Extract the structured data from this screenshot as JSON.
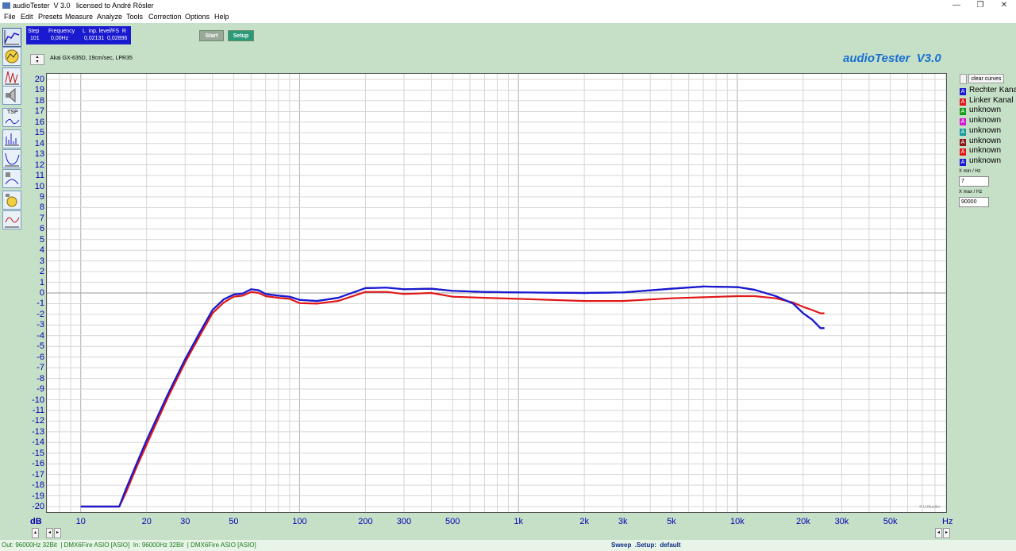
{
  "window": {
    "title": "audioTester  V 3.0   licensed to André Rösler",
    "minimize": "—",
    "maximize": "❐",
    "close": "✕"
  },
  "menu": [
    "File",
    "Edit",
    "Presets",
    "Measure",
    "Analyze",
    "Tools",
    "Correction",
    "Options",
    "Help"
  ],
  "info": {
    "step_label": "Step",
    "frequency_label": "Frequency",
    "level_label": "L  inp. level/FS  R",
    "step_value": "101",
    "frequency_value": "0,00Hz",
    "level_l": "0,02131",
    "level_r": "0,02896"
  },
  "buttons": {
    "start": "Start",
    "setup": "Setup",
    "clear_curves": "clear curves"
  },
  "curve_name": "Akai GX-635D, 19cm/sec, LPR35",
  "app_title": "audioTester  V3.0",
  "toolbar_tsp": "TSP",
  "legend": [
    {
      "label": "Rechter Kanal",
      "color": "#1a1ad0"
    },
    {
      "label": "Linker Kanal",
      "color": "#e01818"
    },
    {
      "label": "unknown",
      "color": "#1a9a1a"
    },
    {
      "label": "unknown",
      "color": "#d01ad0"
    },
    {
      "label": "unknown",
      "color": "#1a9a9a"
    },
    {
      "label": "unknown",
      "color": "#8a1a1a"
    },
    {
      "label": "unknown",
      "color": "#e01818"
    },
    {
      "label": "unknown",
      "color": "#1a1ad0"
    }
  ],
  "xmin": {
    "label": "X min / Hz",
    "value": "7"
  },
  "xmax": {
    "label": "X max / Hz",
    "value": "90000"
  },
  "copyright": "© U.Mueller",
  "status": {
    "left": "Out: 96000Hz 32Bit  | DMX6Fire ASIO [ASIO]  In: 96000Hz 32Bit  | DMX6Fire ASIO [ASIO]",
    "right": "Sweep  .Setup:  default"
  },
  "chart_data": {
    "type": "line",
    "title": "",
    "xlabel": "Hz",
    "ylabel": "dB",
    "xscale": "log",
    "xlim": [
      7,
      90000
    ],
    "ylim": [
      -20,
      20
    ],
    "grid": true,
    "legend_position": "right",
    "x_ticks": [
      "10",
      "20",
      "30",
      "50",
      "100",
      "200",
      "300",
      "500",
      "1k",
      "2k",
      "3k",
      "5k",
      "10k",
      "20k",
      "30k",
      "50k"
    ],
    "y_ticks": [
      "20",
      "19",
      "18",
      "17",
      "16",
      "15",
      "14",
      "13",
      "12",
      "11",
      "10",
      "9",
      "8",
      "7",
      "6",
      "5",
      "4",
      "3",
      "2",
      "1",
      "0",
      "-1",
      "-2",
      "-3",
      "-4",
      "-5",
      "-6",
      "-7",
      "-8",
      "-9",
      "-10",
      "-11",
      "-12",
      "-13",
      "-14",
      "-15",
      "-16",
      "-17",
      "-18",
      "-19",
      "-20"
    ],
    "series": [
      {
        "name": "Rechter Kanal",
        "color": "#1a1ad0",
        "x": [
          10,
          15,
          16,
          18,
          20,
          25,
          30,
          35,
          40,
          45,
          50,
          55,
          60,
          65,
          70,
          80,
          90,
          100,
          120,
          150,
          200,
          250,
          300,
          400,
          500,
          700,
          1000,
          2000,
          3000,
          5000,
          7000,
          10000,
          12000,
          15000,
          18000,
          20000,
          22000,
          24000,
          25000
        ],
        "values": [
          -20,
          -20,
          -18.5,
          -16,
          -13.8,
          -9.5,
          -6.2,
          -3.7,
          -1.6,
          -0.6,
          -0.15,
          -0.05,
          0.35,
          0.25,
          -0.1,
          -0.25,
          -0.35,
          -0.65,
          -0.75,
          -0.45,
          0.45,
          0.5,
          0.35,
          0.4,
          0.2,
          0.1,
          0.05,
          0.0,
          0.05,
          0.4,
          0.6,
          0.55,
          0.3,
          -0.3,
          -1.0,
          -1.9,
          -2.5,
          -3.3,
          -3.3
        ]
      },
      {
        "name": "Linker Kanal",
        "color": "#e01818",
        "x": [
          10,
          15,
          16,
          18,
          20,
          25,
          30,
          35,
          40,
          45,
          50,
          55,
          60,
          65,
          70,
          80,
          90,
          100,
          120,
          150,
          200,
          250,
          300,
          400,
          500,
          700,
          1000,
          2000,
          3000,
          5000,
          7000,
          10000,
          12000,
          15000,
          18000,
          20000,
          22000,
          24000,
          25000
        ],
        "values": [
          -20,
          -20,
          -18.8,
          -16.3,
          -14.2,
          -9.8,
          -6.5,
          -4.0,
          -1.9,
          -0.9,
          -0.35,
          -0.25,
          0.1,
          0.0,
          -0.3,
          -0.45,
          -0.55,
          -0.95,
          -1.0,
          -0.75,
          0.1,
          0.1,
          -0.1,
          0.0,
          -0.35,
          -0.45,
          -0.55,
          -0.75,
          -0.75,
          -0.5,
          -0.4,
          -0.3,
          -0.3,
          -0.5,
          -0.9,
          -1.3,
          -1.6,
          -1.9,
          -1.9
        ]
      }
    ]
  }
}
